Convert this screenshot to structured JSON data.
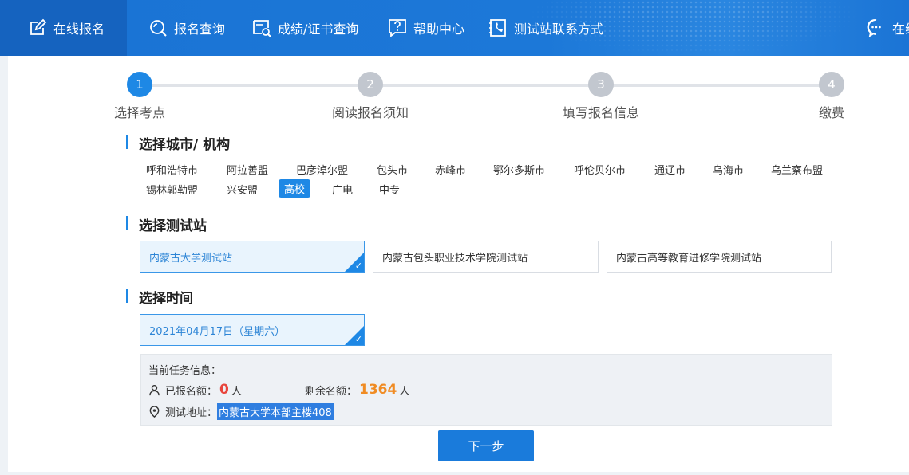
{
  "nav": {
    "items": [
      {
        "label": "在线报名",
        "icon": "edit-icon"
      },
      {
        "label": "报名查询",
        "icon": "search-icon"
      },
      {
        "label": "成绩/证书查询",
        "icon": "certificate-search-icon"
      },
      {
        "label": "帮助中心",
        "icon": "help-icon"
      },
      {
        "label": "测试站联系方式",
        "icon": "phone-book-icon"
      },
      {
        "label": "在线",
        "icon": "chat-icon"
      }
    ]
  },
  "steps": [
    {
      "num": "1",
      "label": "选择考点",
      "active": true
    },
    {
      "num": "2",
      "label": "阅读报名须知",
      "active": false
    },
    {
      "num": "3",
      "label": "填写报名信息",
      "active": false
    },
    {
      "num": "4",
      "label": "缴费",
      "active": false
    }
  ],
  "city_section": {
    "title": "选择城市/ 机构",
    "cities": [
      "呼和浩特市",
      "阿拉善盟",
      "巴彦淖尔盟",
      "包头市",
      "赤峰市",
      "鄂尔多斯市",
      "呼伦贝尔市",
      "通辽市",
      "乌海市",
      "乌兰察布盟",
      "锡林郭勒盟",
      "兴安盟",
      "高校",
      "广电",
      "中专"
    ],
    "selected": "高校"
  },
  "station_section": {
    "title": "选择测试站",
    "stations": [
      "内蒙古大学测试站",
      "内蒙古包头职业技术学院测试站",
      "内蒙古高等教育进修学院测试站"
    ],
    "selected": "内蒙古大学测试站"
  },
  "time_section": {
    "title": "选择时间",
    "slot": "2021年04月17日（星期六）"
  },
  "task_info": {
    "heading": "当前任务信息：",
    "registered_label": "已报名额：",
    "registered_value": "0",
    "registered_unit": "人",
    "remaining_label": "剩余名额：",
    "remaining_value": "1364",
    "remaining_unit": "人",
    "address_label": "测试地址：",
    "address_value": "内蒙古大学本部主楼408"
  },
  "next_button": "下一步",
  "colors": {
    "primary": "#1e88e5",
    "nav_bg": "#1a73d4",
    "red": "#e8453c",
    "orange": "#f08c24"
  }
}
